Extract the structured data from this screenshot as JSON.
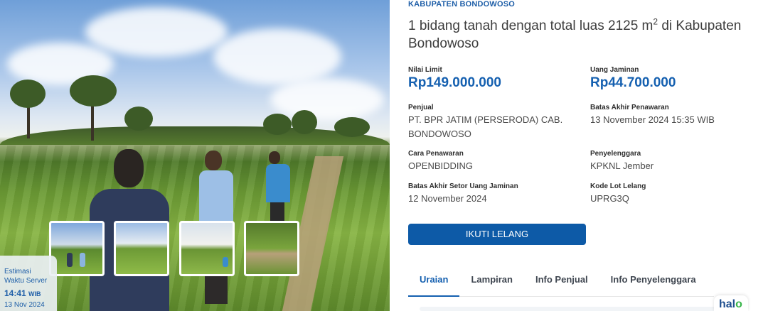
{
  "server": {
    "label_line1": "Estimasi",
    "label_line2": "Waktu Server",
    "time": "14:41",
    "tz": "WIB",
    "date": "13 Nov 2024"
  },
  "lot": {
    "region": "KABUPATEN BONDOWOSO",
    "title_part1": "1 bidang tanah dengan total luas 2125 m",
    "title_sup": "2",
    "title_part2": " di Kabupaten Bondowoso"
  },
  "details": {
    "nilai_limit": {
      "label": "Nilai Limit",
      "value": "Rp149.000.000"
    },
    "uang_jaminan": {
      "label": "Uang Jaminan",
      "value": "Rp44.700.000"
    },
    "penjual": {
      "label": "Penjual",
      "value": "PT. BPR JATIM (PERSERODA) CAB. BONDOWOSO"
    },
    "batas_akhir_penawaran": {
      "label": "Batas Akhir Penawaran",
      "value": "13 November 2024 15:35 WIB"
    },
    "cara_penawaran": {
      "label": "Cara Penawaran",
      "value": "OPENBIDDING"
    },
    "penyelenggara": {
      "label": "Penyelenggara",
      "value": "KPKNL Jember"
    },
    "batas_setor": {
      "label": "Batas Akhir Setor Uang Jaminan",
      "value": "12 November 2024"
    },
    "kode_lot": {
      "label": "Kode Lot Lelang",
      "value": "UPRG3Q"
    }
  },
  "actions": {
    "follow_label": "IKUTI LELANG"
  },
  "tabs": [
    {
      "label": "Uraian",
      "active": true
    },
    {
      "label": "Lampiran",
      "active": false
    },
    {
      "label": "Info Penjual",
      "active": false
    },
    {
      "label": "Info Penyelenggara",
      "active": false
    }
  ],
  "brand": {
    "logo_text_1": "hal",
    "logo_text_2": "o"
  },
  "colors": {
    "accent": "#1560b0",
    "button": "#0d5aa7"
  }
}
